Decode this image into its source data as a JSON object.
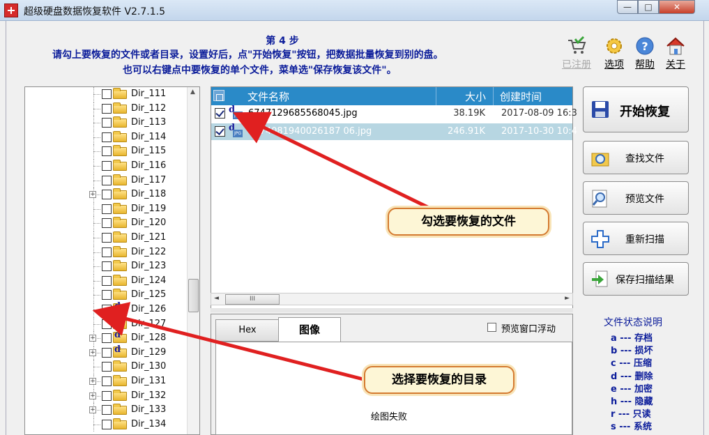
{
  "window": {
    "title": "超级硬盘数据恢复软件 V2.7.1.5",
    "min": "—",
    "max": "□",
    "close": "✕"
  },
  "step": {
    "title": "第 4 步",
    "line1": "请勾上要恢复的文件或者目录，设置好后，点\"开始恢复\"按钮，把数据批量恢复到别的盘。",
    "line2": "也可以右键点中要恢复的单个文件，菜单选\"保存恢复该文件\"。"
  },
  "toolbar": {
    "register": "已注册",
    "options": "选项",
    "help": "帮助",
    "about": "关于"
  },
  "tree": {
    "items": [
      {
        "name": "Dir_111",
        "expand": false,
        "checked": false,
        "marked": false
      },
      {
        "name": "Dir_112",
        "expand": false,
        "checked": false,
        "marked": false
      },
      {
        "name": "Dir_113",
        "expand": false,
        "checked": false,
        "marked": false
      },
      {
        "name": "Dir_114",
        "expand": false,
        "checked": false,
        "marked": false
      },
      {
        "name": "Dir_115",
        "expand": false,
        "checked": false,
        "marked": false
      },
      {
        "name": "Dir_116",
        "expand": false,
        "checked": false,
        "marked": false
      },
      {
        "name": "Dir_117",
        "expand": false,
        "checked": false,
        "marked": false
      },
      {
        "name": "Dir_118",
        "expand": true,
        "checked": false,
        "marked": false
      },
      {
        "name": "Dir_119",
        "expand": false,
        "checked": false,
        "marked": false
      },
      {
        "name": "Dir_120",
        "expand": false,
        "checked": false,
        "marked": false
      },
      {
        "name": "Dir_121",
        "expand": false,
        "checked": false,
        "marked": false
      },
      {
        "name": "Dir_122",
        "expand": false,
        "checked": false,
        "marked": false
      },
      {
        "name": "Dir_123",
        "expand": false,
        "checked": false,
        "marked": false
      },
      {
        "name": "Dir_124",
        "expand": false,
        "checked": false,
        "marked": false
      },
      {
        "name": "Dir_125",
        "expand": false,
        "checked": false,
        "marked": false
      },
      {
        "name": "Dir_126",
        "expand": false,
        "checked": true,
        "marked": true
      },
      {
        "name": "Dir_127",
        "expand": false,
        "checked": false,
        "marked": true
      },
      {
        "name": "Dir_128",
        "expand": true,
        "checked": false,
        "marked": true
      },
      {
        "name": "Dir_129",
        "expand": true,
        "checked": false,
        "marked": true
      },
      {
        "name": "Dir_130",
        "expand": false,
        "checked": false,
        "marked": false
      },
      {
        "name": "Dir_131",
        "expand": true,
        "checked": false,
        "marked": false
      },
      {
        "name": "Dir_132",
        "expand": true,
        "checked": false,
        "marked": false
      },
      {
        "name": "Dir_133",
        "expand": true,
        "checked": false,
        "marked": false
      },
      {
        "name": "Dir_134",
        "expand": false,
        "checked": false,
        "marked": false
      }
    ]
  },
  "filelist": {
    "headers": {
      "name": "文件名称",
      "size": "大小",
      "created": "创建时间"
    },
    "rows": [
      {
        "name": "6747129685568045.jpg",
        "size": "38.19K",
        "created": "2017-08-09 16:3",
        "checked": true,
        "selected": false
      },
      {
        "name": "1374081940026187 06.jpg",
        "size": "246.91K",
        "created": "2017-10-30 10:4",
        "checked": true,
        "selected": true
      }
    ]
  },
  "preview": {
    "tab_hex": "Hex",
    "tab_image": "图像",
    "float_label": "预览窗口浮动",
    "message": "绘图失败"
  },
  "actions": {
    "start": "开始恢复",
    "find": "查找文件",
    "preview": "预览文件",
    "rescan": "重新扫描",
    "save": "保存扫描结果"
  },
  "legend": {
    "title": "文件状态说明",
    "items": [
      "a --- 存档",
      "b --- 损坏",
      "c --- 压缩",
      "d --- 删除",
      "e --- 加密",
      "h --- 隐藏",
      "r --- 只读",
      "s --- 系统"
    ]
  },
  "callouts": {
    "file": "勾选要恢复的文件",
    "dir": "选择要恢复的目录"
  },
  "colors": {
    "accent": "#2a8ac8",
    "text_blue": "#0b1c9a",
    "arrow": "#e02020",
    "callout_border": "#d47a30"
  },
  "icons": {
    "mark": "d",
    "jpg": "JPG",
    "scroll_thumb": "III",
    "left": "◄",
    "right": "►",
    "up": "▲"
  }
}
